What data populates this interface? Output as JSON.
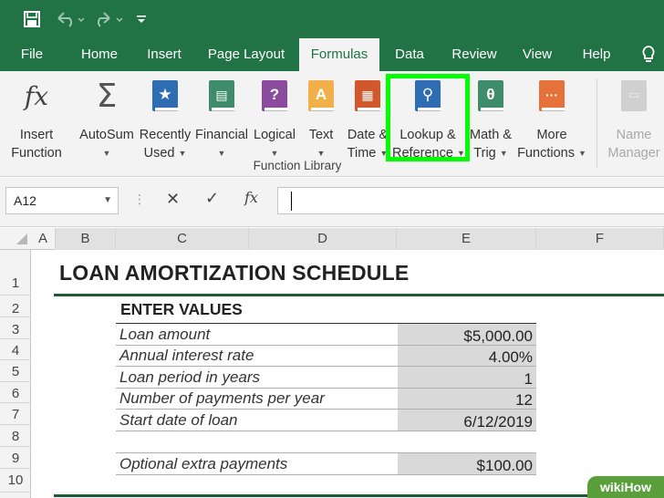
{
  "tabs": [
    "File",
    "Home",
    "Insert",
    "Page Layout",
    "Formulas",
    "Data",
    "Review",
    "View",
    "Help"
  ],
  "ribbon": {
    "insert_function": [
      "Insert",
      "Function"
    ],
    "autosum": "AutoSum",
    "recently_used": [
      "Recently",
      "Used"
    ],
    "financial": "Financial",
    "logical": "Logical",
    "text": "Text",
    "date_time": [
      "Date &",
      "Time"
    ],
    "lookup_reference": [
      "Lookup &",
      "Reference"
    ],
    "math_trig": [
      "Math &",
      "Trig"
    ],
    "more_functions": [
      "More",
      "Functions"
    ],
    "name_manager": [
      "Name",
      "Manager"
    ],
    "group_label": "Function Library",
    "icon_glyphs": {
      "fx": "fx",
      "sigma": "Σ",
      "logical": "?",
      "text": "A",
      "math": "θ"
    }
  },
  "formula_bar": {
    "name_box": "A12",
    "formula_value": "",
    "fx_label": "fx"
  },
  "columns": [
    "A",
    "B",
    "C",
    "D",
    "E",
    "F"
  ],
  "rows": [
    "1",
    "2",
    "3",
    "4",
    "5",
    "6",
    "7",
    "8",
    "9",
    "10"
  ],
  "sheet": {
    "title": "LOAN AMORTIZATION SCHEDULE",
    "section": "ENTER VALUES",
    "entries": [
      {
        "label": "Loan amount",
        "value": "$5,000.00"
      },
      {
        "label": "Annual interest rate",
        "value": "4.00%"
      },
      {
        "label": "Loan period in years",
        "value": "1"
      },
      {
        "label": "Number of payments per year",
        "value": "12"
      },
      {
        "label": "Start date of loan",
        "value": "6/12/2019"
      }
    ],
    "extra": {
      "label": "Optional extra payments",
      "value": "$100.00"
    }
  },
  "watermark": "wikiHow",
  "colors": {
    "excel_green": "#217346",
    "highlight": "#00ff00",
    "ribbon_bg": "#f3f3f3"
  }
}
